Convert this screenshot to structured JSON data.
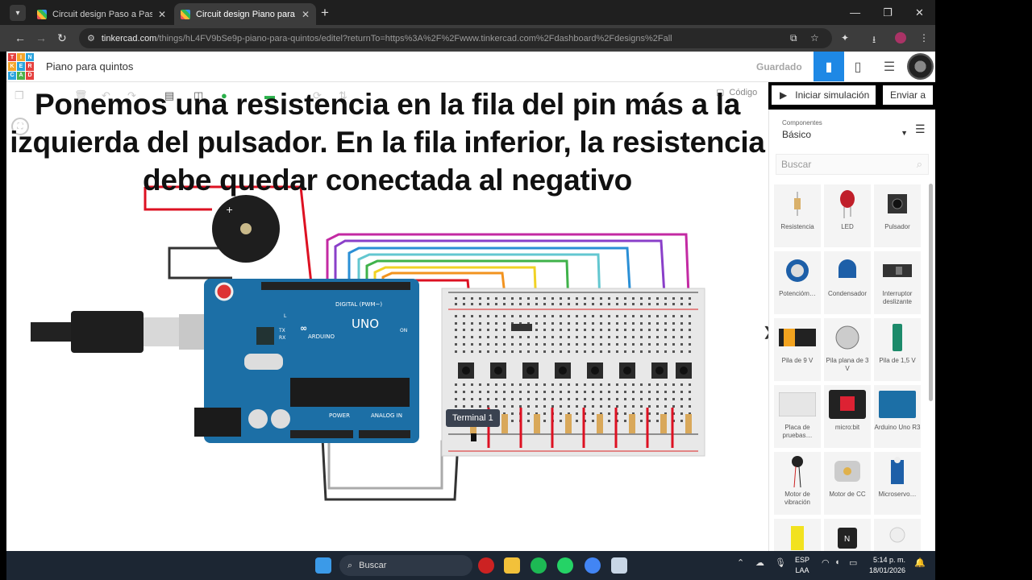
{
  "browser": {
    "tabs": [
      {
        "title": "Circuit design Paso a Paso Cone",
        "active": false
      },
      {
        "title": "Circuit design Piano para quint",
        "active": true
      }
    ],
    "url_host": "tinkercad.com",
    "url_path": "/things/hL4FV9bSe9p-piano-para-quintos/editel?returnTo=https%3A%2F%2Fwww.tinkercad.com%2Fdashboard%2Fdesigns%2Fall"
  },
  "header": {
    "logo_letters": [
      "TIN",
      "KER",
      "CAD"
    ],
    "project_name": "Piano para quintos",
    "save_status": "Guardado"
  },
  "toolbar": {
    "code_label": "Código",
    "start_sim_label": "Iniciar simulación",
    "send_label": "Enviar a"
  },
  "overlay_caption": "Ponemos una resistencia en la fila del pin más a la izquierda del pulsador. En la fila inferior, la resistencia debe quedar conectada al negativo",
  "canvas": {
    "tooltip": "Terminal 1",
    "arduino": {
      "brand": "ARDUINO",
      "model": "UNO",
      "digital_label": "DIGITAL (PWM~)",
      "power_label": "POWER",
      "analog_label": "ANALOG IN",
      "on_label": "ON",
      "tx": "TX",
      "rx": "RX",
      "l": "L"
    }
  },
  "panel": {
    "category_label": "Componentes",
    "category_value": "Básico",
    "search_placeholder": "Buscar",
    "components": [
      {
        "name": "Resistencia",
        "icon": "resistor-icon"
      },
      {
        "name": "LED",
        "icon": "led-icon"
      },
      {
        "name": "Pulsador",
        "icon": "pushbutton-icon"
      },
      {
        "name": "Potencióm…",
        "icon": "potentiometer-icon"
      },
      {
        "name": "Condensador",
        "icon": "capacitor-icon"
      },
      {
        "name": "Interruptor deslizante",
        "icon": "slide-switch-icon"
      },
      {
        "name": "Pila de 9 V",
        "icon": "battery-9v-icon"
      },
      {
        "name": "Pila plana de 3 V",
        "icon": "coin-cell-icon"
      },
      {
        "name": "Pila de 1,5 V",
        "icon": "battery-aa-icon"
      },
      {
        "name": "Placa de pruebas…",
        "icon": "breadboard-icon"
      },
      {
        "name": "micro:bit",
        "icon": "microbit-icon"
      },
      {
        "name": "Arduino Uno R3",
        "icon": "arduino-icon"
      },
      {
        "name": "Motor de vibración",
        "icon": "vibration-motor-icon"
      },
      {
        "name": "Motor de CC",
        "icon": "dc-motor-icon"
      },
      {
        "name": "Microservo…",
        "icon": "servo-icon"
      },
      {
        "name": "",
        "icon": "battery-pack-icon"
      },
      {
        "name": "",
        "icon": "n-mosfet-icon"
      },
      {
        "name": "",
        "icon": "lightbulb-icon"
      }
    ]
  },
  "taskbar": {
    "search_label": "Buscar",
    "lang_line1": "ESP",
    "lang_line2": "LAA",
    "time": "5:14 p. m.",
    "date": "18/01/2026"
  },
  "colors": {
    "accent": "#1e88e5",
    "arduino_blue": "#1c6fa6",
    "breadboard": "#e8e8e8"
  }
}
